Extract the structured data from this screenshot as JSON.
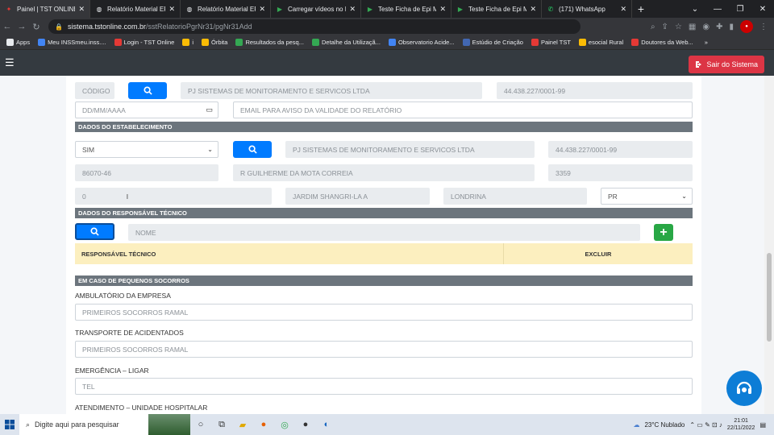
{
  "browser": {
    "tabs": [
      {
        "title": "Painel | TST ONLINE",
        "icon": "tst-icon",
        "active": true
      },
      {
        "title": "Relatório Material EPI",
        "icon": "globe-icon"
      },
      {
        "title": "Relatório Material EPI",
        "icon": "globe-icon"
      },
      {
        "title": "Carregar vídeos no R",
        "icon": "play-icon"
      },
      {
        "title": "Teste Ficha de Epi Ma",
        "icon": "play-icon"
      },
      {
        "title": "Teste Ficha de Epi Ma",
        "icon": "play-icon"
      },
      {
        "title": "(171) WhatsApp",
        "icon": "whatsapp-icon"
      }
    ],
    "url_host": "sistema.tstonline.com.br",
    "url_path": "/sstRelatorioPgrNr31/pgNr31Add",
    "bookmarks": [
      {
        "label": "Apps",
        "color": "#e8eaed"
      },
      {
        "label": "Meu INSSmeu.inss....",
        "color": "#4285f4"
      },
      {
        "label": "Login - TST Online",
        "color": "#e53935"
      },
      {
        "label": "i",
        "color": "#fbbc05"
      },
      {
        "label": "Órbita",
        "color": "#fbbc05"
      },
      {
        "label": "Resultados da pesq...",
        "color": "#34a853"
      },
      {
        "label": "Detalhe da Utilizaçã...",
        "color": "#34a853"
      },
      {
        "label": "Observatorio Acide...",
        "color": "#4285f4"
      },
      {
        "label": "Estúdio de Criação",
        "color": "#4267b2"
      },
      {
        "label": "Painel TST",
        "color": "#e53935"
      },
      {
        "label": "esocial Rural",
        "color": "#fbbc05"
      },
      {
        "label": "Doutores da Web...",
        "color": "#e53935"
      }
    ]
  },
  "app": {
    "logout_label": "Sair do Sistema"
  },
  "form": {
    "codigo_placeholder": "CÓDIGO",
    "company_name": "PJ SISTEMAS DE MONITORAMENTO E SERVICOS LTDA",
    "company_cnpj": "44.438.227/0001-99",
    "date_placeholder": "DD/MM/AAAA",
    "email_placeholder": "EMAIL PARA AVISO DA VALIDADE DO RELATÓRIO",
    "section_estabelecimento": "DADOS DO ESTABELECIMENTO",
    "estab_select": "SIM",
    "estab_name": "PJ SISTEMAS DE MONITORAMENTO E SERVICOS LTDA",
    "estab_cnpj": "44.438.227/0001-99",
    "cep": "86070-46",
    "street": "R GUILHERME DA MOTA CORREIA",
    "number": "3359",
    "complement": "0",
    "district": "JARDIM SHANGRI-LA A",
    "city": "LONDRINA",
    "state": "PR",
    "section_responsavel": "DADOS DO RESPONSÁVEL TÉCNICO",
    "nome_placeholder": "NOME",
    "table_col1": "RESPONSÁVEL TÉCNICO",
    "table_col2": "EXCLUIR",
    "section_socorros": "EM CASO DE PEQUENOS SOCORROS",
    "ambulatorio_label": "AMBULATÓRIO DA EMPRESA",
    "ambulatorio_placeholder": "PRIMEIROS SOCORROS RAMAL",
    "transporte_label": "TRANSPORTE DE ACIDENTADOS",
    "transporte_placeholder": "PRIMEIROS SOCORROS RAMAL",
    "emergencia_label": "EMERGÊNCIA – LIGAR",
    "emergencia_placeholder": "TEL",
    "atendimento_label": "ATENDIMENTO – UNIDADE HOSPITALAR"
  },
  "taskbar": {
    "search_placeholder": "Digite aqui para pesquisar",
    "weather": "23°C  Nublado",
    "time": "21:01",
    "date": "22/11/2022"
  }
}
